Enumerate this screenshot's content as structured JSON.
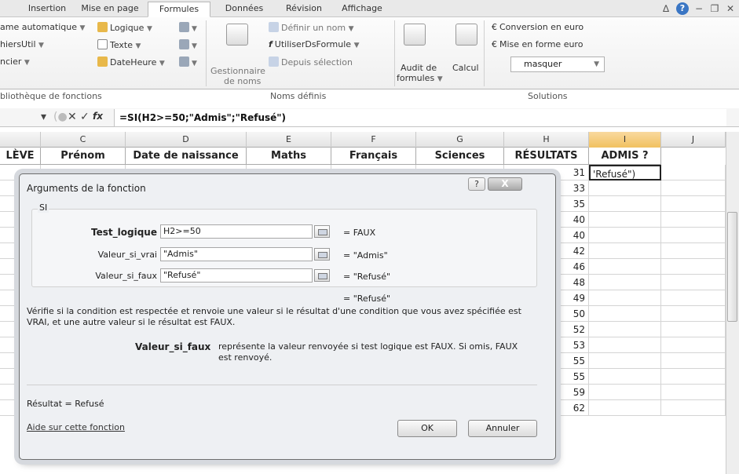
{
  "tabs": [
    "Insertion",
    "Mise en page",
    "Formules",
    "Données",
    "Révision",
    "Affichage"
  ],
  "active_tab": "Formules",
  "ribbon": {
    "lib_items": [
      {
        "label": "ame automatique",
        "dropdown": true
      },
      {
        "label": "Logique",
        "dropdown": true
      },
      {
        "label": "hiersUtil",
        "dropdown": true
      },
      {
        "label": "Texte",
        "dropdown": true
      },
      {
        "label": "ncier",
        "dropdown": true
      },
      {
        "label": "DateHeure",
        "dropdown": true
      }
    ],
    "lib_group_label": "bliothèque de fonctions",
    "names_manager_label_1": "Gestionnaire",
    "names_manager_label_2": "de noms",
    "define_name": "Définir un nom",
    "use_in_formula": "UtiliserDsFormule",
    "from_selection": "Depuis sélection",
    "names_group_label": "Noms définis",
    "audit_label_1": "Audit de",
    "audit_label_2": "formules",
    "calc_label": "Calcul",
    "conversion_euro": "Conversion en euro",
    "format_euro": "Mise en forme euro",
    "masquer": "masquer",
    "solutions_label": "Solutions"
  },
  "formula_bar": {
    "formula": "=SI(H2>=50;\"Admis\";\"Refusé\")"
  },
  "columns": [
    "C",
    "D",
    "E",
    "F",
    "G",
    "H",
    "I",
    "J"
  ],
  "headers": {
    "eleve": "LÈVE",
    "prenom": "Prénom",
    "date": "Date de naissance",
    "maths": "Maths",
    "francais": "Français",
    "sciences": "Sciences",
    "resultats": "RÉSULTATS",
    "admis": "ADMIS ?"
  },
  "resultats": [
    31,
    33,
    35,
    40,
    40,
    42,
    46,
    48,
    49,
    50,
    52,
    53,
    55,
    55,
    59,
    62
  ],
  "i_first_cell": "'Refusé\")",
  "dialog": {
    "title": "Arguments de la fonction",
    "help_btn": "?",
    "close_btn": "X",
    "function": "SI",
    "args": [
      {
        "label": "Test_logique",
        "value": "H2>=50",
        "result": "= FAUX"
      },
      {
        "label": "Valeur_si_vrai",
        "value": "\"Admis\"",
        "result": "= \"Admis\""
      },
      {
        "label": "Valeur_si_faux",
        "value": "\"Refusé\"",
        "result": "= \"Refusé\""
      }
    ],
    "overall_result": "= \"Refusé\"",
    "description": "Vérifie si la condition est respectée et renvoie une valeur si le résultat d'une condition que vous avez spécifiée est VRAI, et une autre valeur si le résultat est FAUX.",
    "arg_help_name": "Valeur_si_faux",
    "arg_help_text": "représente la valeur renvoyée si test logique est FAUX. Si omis, FAUX est renvoyé.",
    "resultat_label": "Résultat =",
    "resultat_value": "Refusé",
    "help_link": "Aide sur cette fonction",
    "ok": "OK",
    "cancel": "Annuler"
  }
}
